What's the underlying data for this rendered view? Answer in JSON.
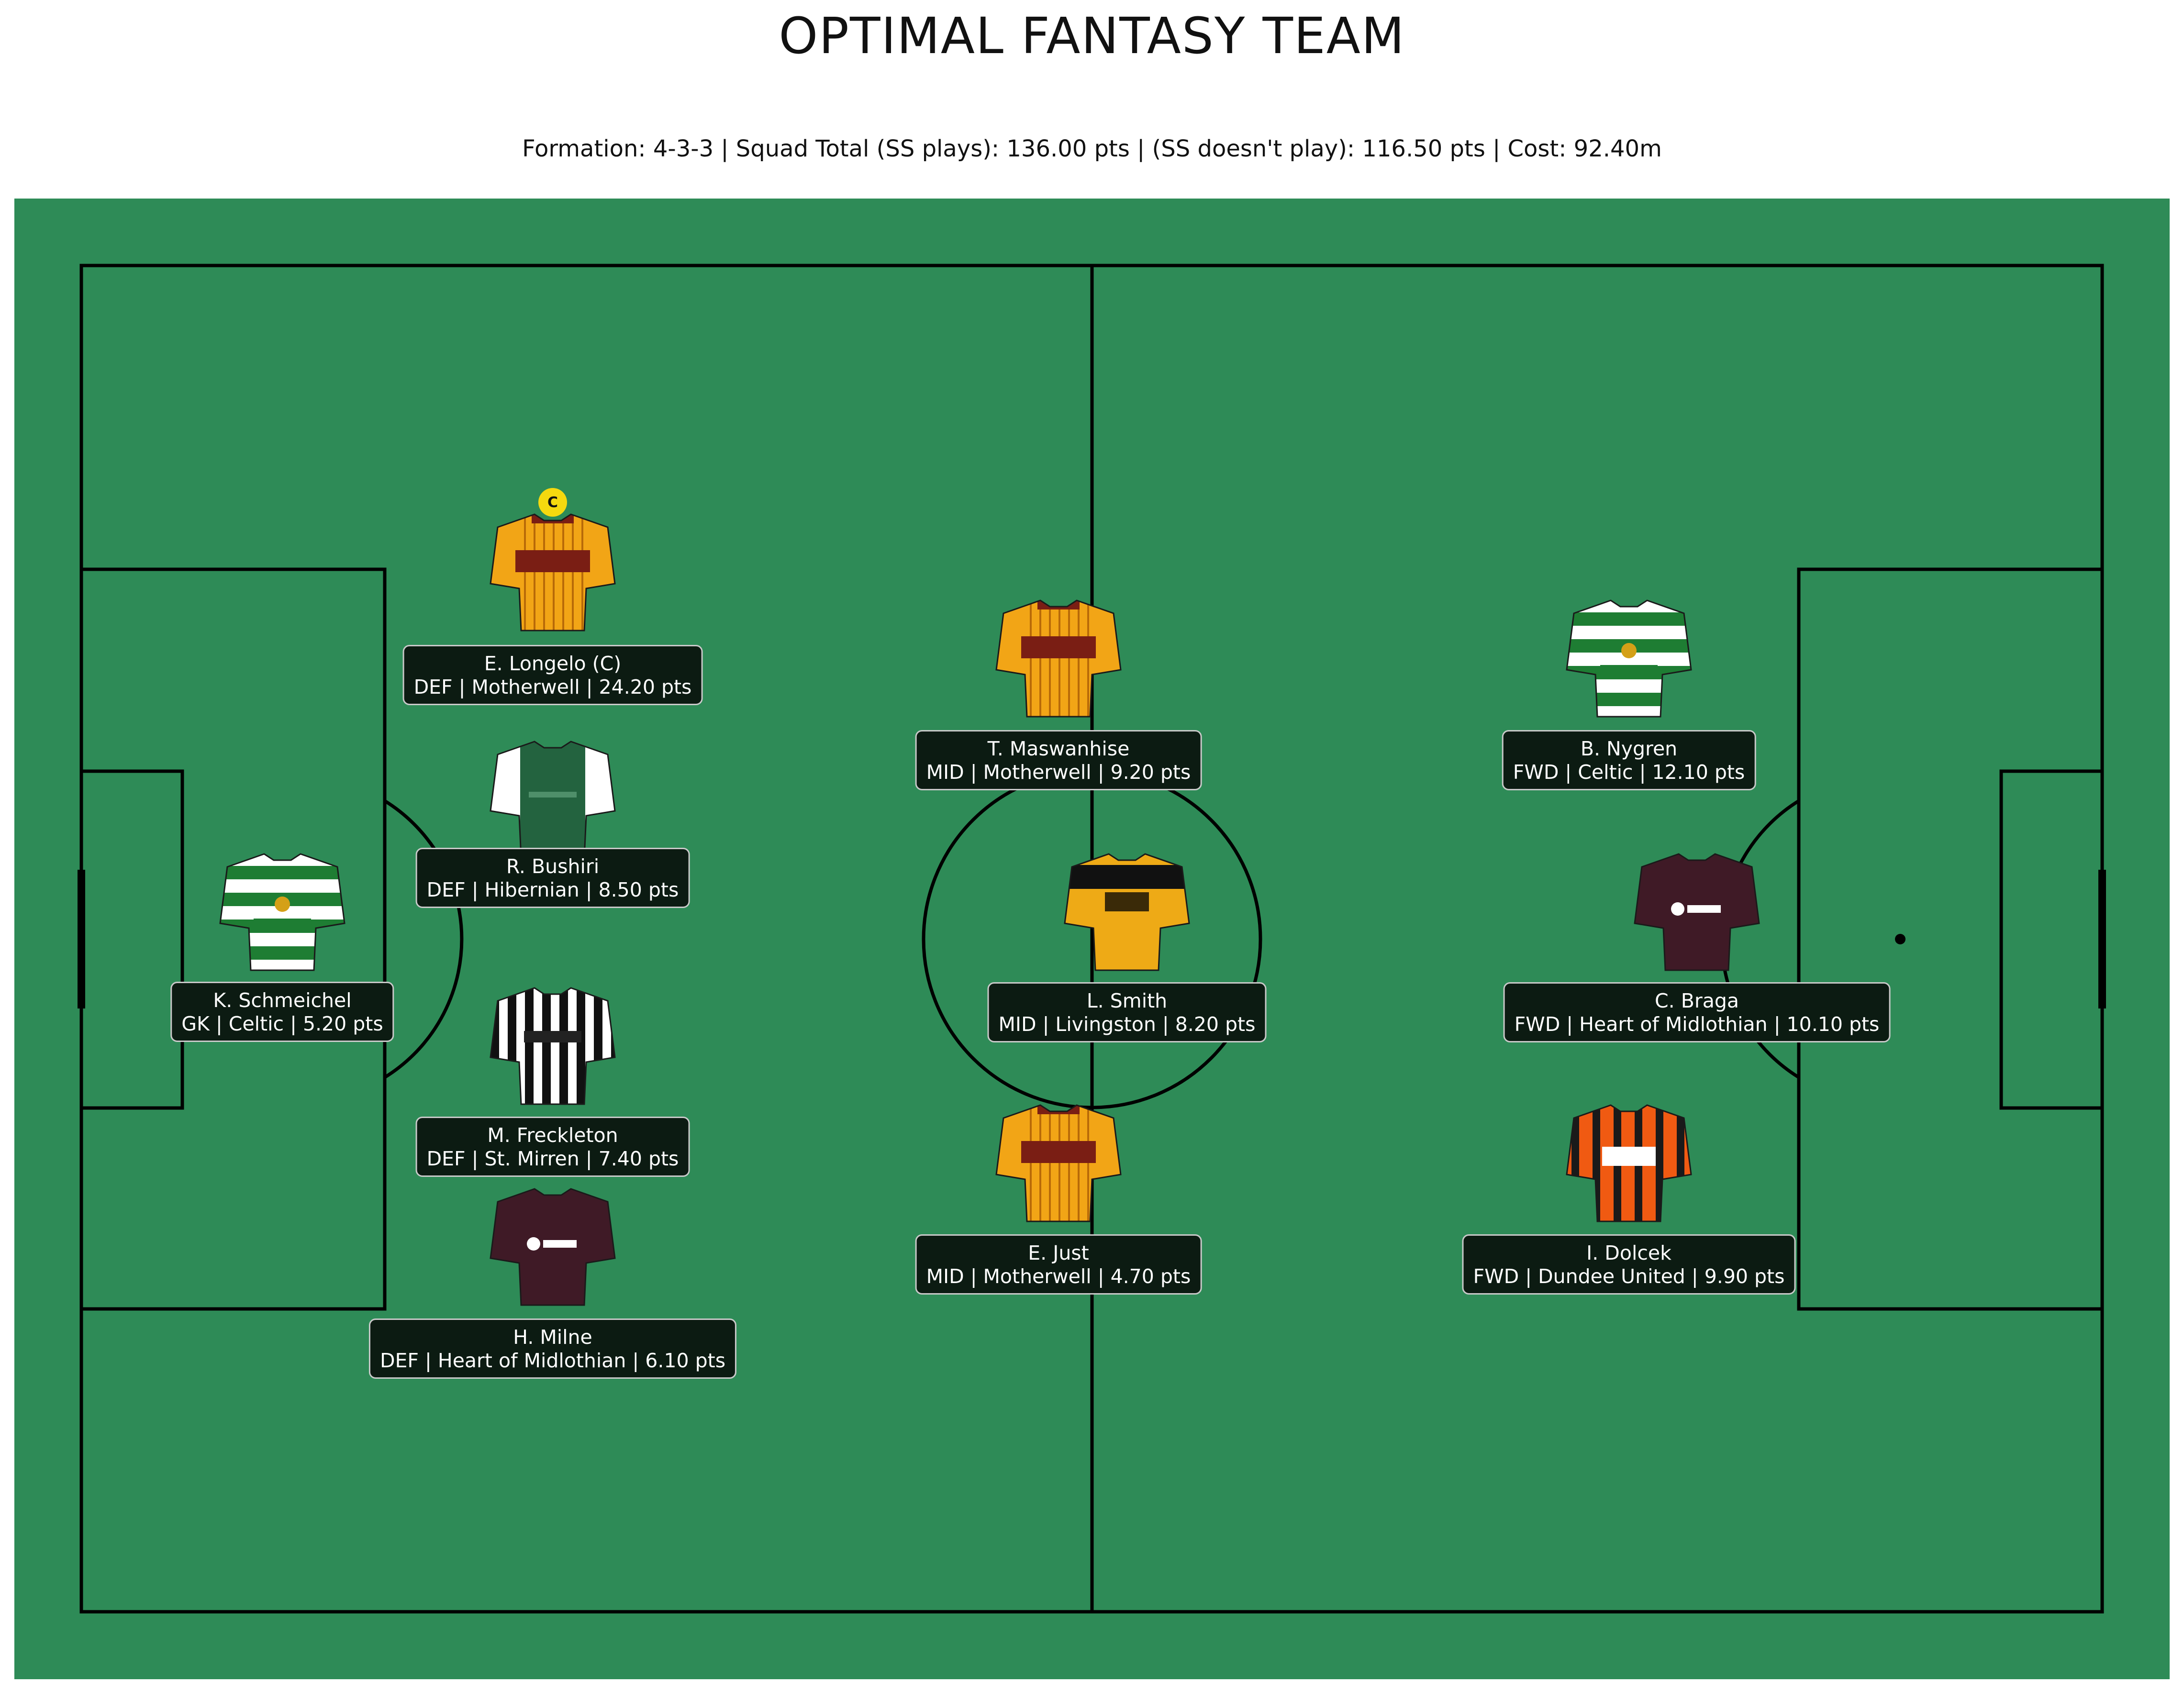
{
  "title": "OPTIMAL FANTASY TEAM",
  "subtitle": "Formation: 4-3-3  |  Squad Total (SS plays): 136.00 pts  |  (SS doesn't play): 116.50 pts  |  Cost: 92.40m",
  "colors": {
    "pitch": "#2e8b57",
    "lines": "#000000",
    "label_bg": "#0c1b12",
    "captain_badge": "#f5d90f"
  },
  "captain_badge_text": "C",
  "players": [
    {
      "id": "schmeichel",
      "name": "K. Schmeichel",
      "info": "GK | Celtic | 5.20 pts",
      "kit": "celtic"
    },
    {
      "id": "longelo",
      "name": "E. Longelo (C)",
      "info": "DEF | Motherwell | 24.20 pts",
      "kit": "motherwell",
      "captain": true
    },
    {
      "id": "bushiri",
      "name": "R. Bushiri",
      "info": "DEF | Hibernian | 8.50 pts",
      "kit": "hibernian"
    },
    {
      "id": "freckleton",
      "name": "M. Freckleton",
      "info": "DEF | St. Mirren | 7.40 pts",
      "kit": "stmirren"
    },
    {
      "id": "milne",
      "name": "H. Milne",
      "info": "DEF | Heart of Midlothian | 6.10 pts",
      "kit": "hearts"
    },
    {
      "id": "maswanhise",
      "name": "T. Maswanhise",
      "info": "MID | Motherwell | 9.20 pts",
      "kit": "motherwell"
    },
    {
      "id": "smith",
      "name": "L. Smith",
      "info": "MID | Livingston | 8.20 pts",
      "kit": "livingston"
    },
    {
      "id": "just",
      "name": "E. Just",
      "info": "MID | Motherwell | 4.70 pts",
      "kit": "motherwell"
    },
    {
      "id": "nygren",
      "name": "B. Nygren",
      "info": "FWD | Celtic | 12.10 pts",
      "kit": "celtic"
    },
    {
      "id": "braga",
      "name": "C. Braga",
      "info": "FWD | Heart of Midlothian | 10.10 pts",
      "kit": "hearts"
    },
    {
      "id": "dolcek",
      "name": "I. Dolcek",
      "info": "FWD | Dundee United | 9.90 pts",
      "kit": "dundeeutd"
    }
  ]
}
